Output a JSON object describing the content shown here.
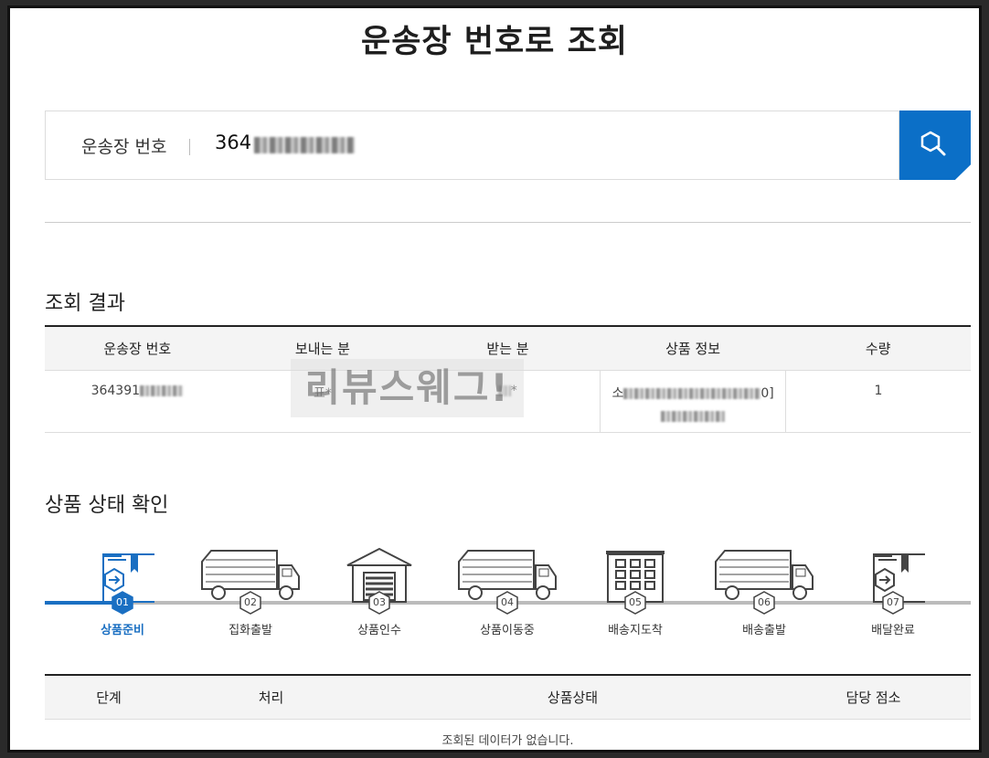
{
  "page_title": "운송장 번호로 조회",
  "search": {
    "label": "운송장 번호",
    "value_prefix": "364",
    "button_icon": "search-icon"
  },
  "result": {
    "section_title": "조회 결과",
    "columns": [
      "운송장 번호",
      "보내는 분",
      "받는 분",
      "상품 정보",
      "수량"
    ],
    "row": {
      "tracking_prefix": "364391",
      "sender_prefix": "표*",
      "receiver_prefix": "*",
      "product_prefix": "소",
      "product_suffix": "0]",
      "quantity": "1"
    }
  },
  "watermark": "리뷰스웨그!",
  "status": {
    "section_title": "상품 상태 확인",
    "active_color": "#1a6fc2",
    "steps": [
      {
        "num": "01",
        "label": "상품준비",
        "icon": "box-arrow-icon",
        "active": true
      },
      {
        "num": "02",
        "label": "집화출발",
        "icon": "truck-icon",
        "active": false
      },
      {
        "num": "03",
        "label": "상품인수",
        "icon": "warehouse-icon",
        "active": false
      },
      {
        "num": "04",
        "label": "상품이동중",
        "icon": "truck-icon",
        "active": false
      },
      {
        "num": "05",
        "label": "배송지도착",
        "icon": "building-icon",
        "active": false
      },
      {
        "num": "06",
        "label": "배송출발",
        "icon": "truck-icon",
        "active": false
      },
      {
        "num": "07",
        "label": "배달완료",
        "icon": "box-arrow-icon",
        "active": false
      }
    ]
  },
  "history": {
    "columns": [
      "단계",
      "처리",
      "상품상태",
      "담당 점소"
    ],
    "empty_message": "조회된 데이터가 없습니다."
  }
}
